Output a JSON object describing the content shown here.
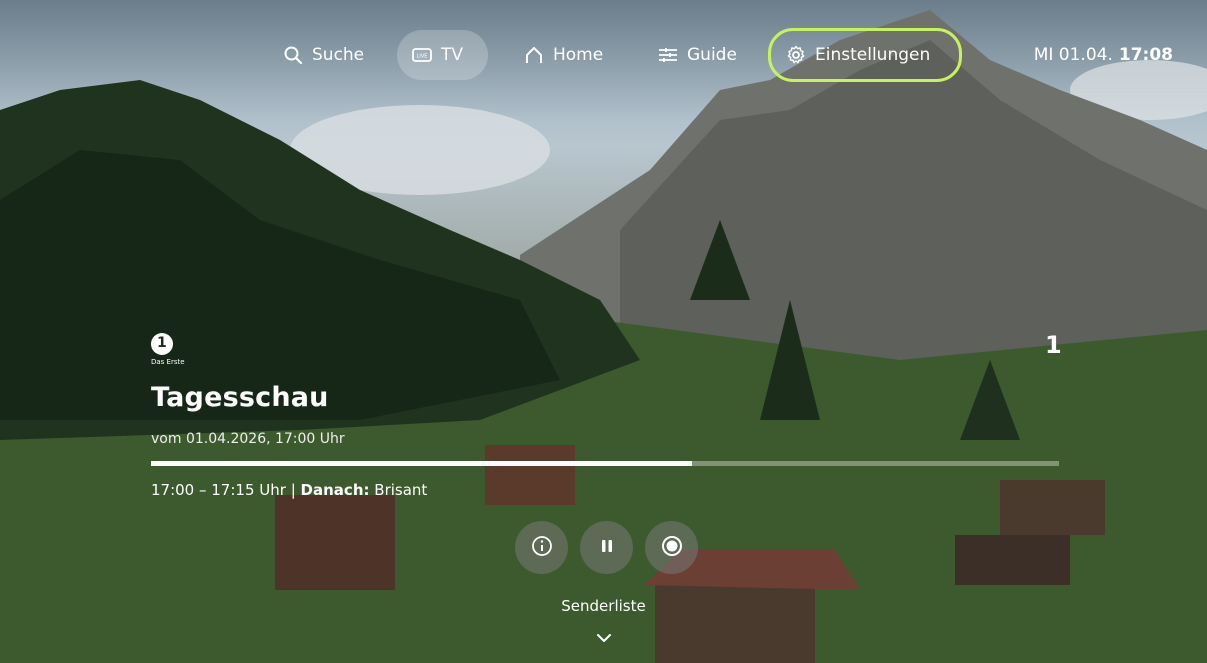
{
  "nav": {
    "search_label": "Suche",
    "tv_label": "TV",
    "home_label": "Home",
    "guide_label": "Guide",
    "settings_label": "Einstellungen",
    "clock_date": "MI 01.04.",
    "clock_time": "17:08"
  },
  "player": {
    "channel_name": "Das Erste",
    "channel_number": "1",
    "title": "Tagesschau",
    "date_line": "vom 01.04.2026, 17:00 Uhr",
    "progress": 0.596,
    "time_range": "17:00 – 17:15 Uhr",
    "separator": "|",
    "next_label": "Danach:",
    "next_title": "Brisant"
  },
  "footer": {
    "channel_list_label": "Senderliste"
  },
  "icons": [
    "search-icon",
    "live-tv-icon",
    "home-icon",
    "guide-icon",
    "gear-icon",
    "info-icon",
    "pause-icon",
    "record-icon",
    "chevron-down-icon"
  ],
  "colors": {
    "focus_ring": "#c6f25c",
    "text": "#ffffff"
  }
}
